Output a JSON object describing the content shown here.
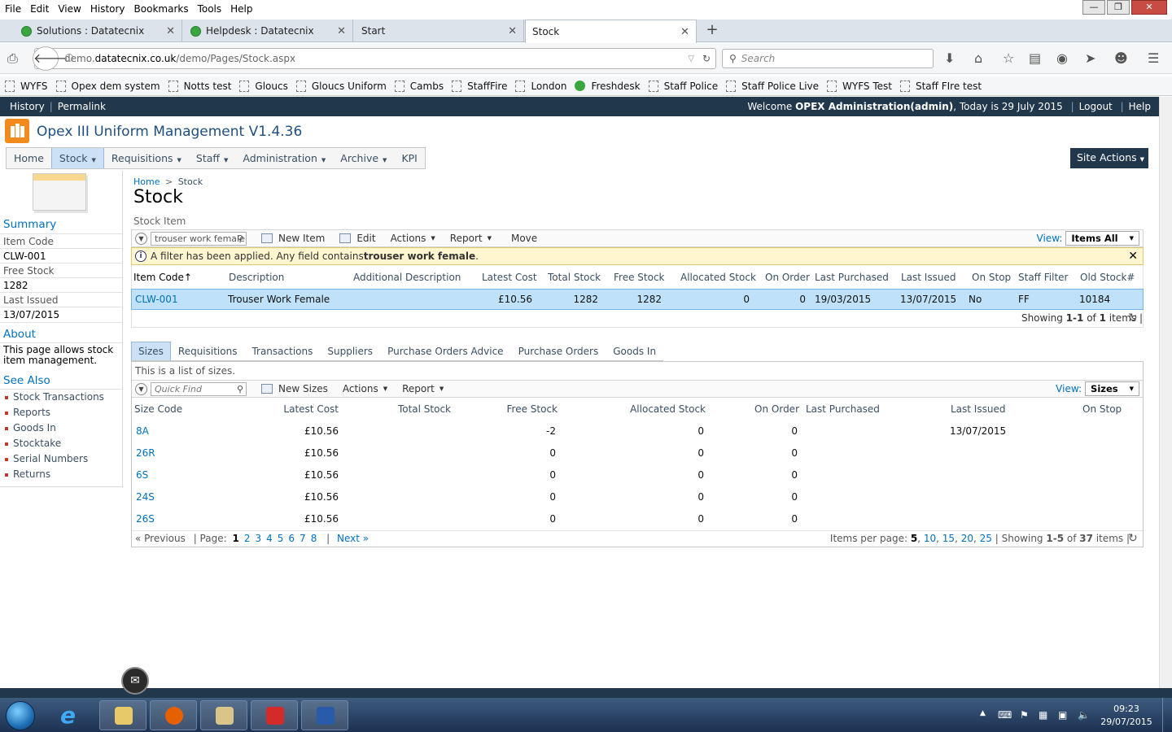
{
  "browser": {
    "menu": [
      "File",
      "Edit",
      "View",
      "History",
      "Bookmarks",
      "Tools",
      "Help"
    ],
    "tabs": [
      {
        "label": "Solutions : Datatecnix"
      },
      {
        "label": "Helpdesk : Datatecnix"
      },
      {
        "label": "Start"
      },
      {
        "label": "Stock"
      }
    ],
    "url_prefix": "demo.",
    "url_host": "datatecnix.co.uk",
    "url_path": "/demo/Pages/Stock.aspx",
    "search_placeholder": "Search",
    "bookmarks": [
      "WYFS",
      "Opex dem system",
      "Notts test",
      "Gloucs",
      "Gloucs Uniform",
      "Cambs",
      "StaffFire",
      "London",
      "Freshdesk",
      "Staff Police",
      "Staff Police Live",
      "WYFS Test",
      "Staff FIre test"
    ]
  },
  "sp": {
    "history": "History",
    "permalink": "Permalink",
    "welcome_prefix": "Welcome ",
    "welcome_user": "OPEX Administration(admin)",
    "welcome_date": ", Today is 29 July 2015",
    "logout": "Logout",
    "help": "Help",
    "app_title": "Opex III Uniform Management V1.4.36",
    "site_actions": "Site Actions",
    "topnav": [
      {
        "label": "Home",
        "dropdown": false
      },
      {
        "label": "Stock",
        "dropdown": true
      },
      {
        "label": "Requisitions",
        "dropdown": true
      },
      {
        "label": "Staff",
        "dropdown": true
      },
      {
        "label": "Administration",
        "dropdown": true
      },
      {
        "label": "Archive",
        "dropdown": true
      },
      {
        "label": "KPI",
        "dropdown": false
      }
    ]
  },
  "leftnav": {
    "summary_heading": "Summary",
    "item_code_label": "Item Code",
    "item_code_value": "CLW-001",
    "free_stock_label": "Free Stock",
    "free_stock_value": "1282",
    "last_issued_label": "Last Issued",
    "last_issued_value": "13/07/2015",
    "about_heading": "About",
    "about_text": "This page allows stock item management.",
    "see_also_heading": "See Also",
    "links": [
      "Stock Transactions",
      "Reports",
      "Goods In",
      "Stocktake",
      "Serial Numbers",
      "Returns"
    ]
  },
  "main": {
    "breadcrumb_home": "Home",
    "breadcrumb_sep": ">",
    "breadcrumb_current": "Stock",
    "title": "Stock",
    "section_label": "Stock Item",
    "toolbar": {
      "search_value": "trouser work female",
      "new_item": "New Item",
      "edit": "Edit",
      "actions": "Actions",
      "report": "Report",
      "move": "Move",
      "view_label": "View:",
      "view_value": "Items All"
    },
    "filter_prefix": "A filter has been applied. Any field contains ",
    "filter_term": "trouser work female",
    "filter_suffix": ".",
    "columns": [
      "Item Code",
      "Description",
      "Additional Description",
      "Latest Cost",
      "Total Stock",
      "Free Stock",
      "Allocated Stock",
      "On Order",
      "Last Purchased",
      "Last Issued",
      "On Stop",
      "Staff Filter",
      "Old Stock#"
    ],
    "sort_arrow": "↑",
    "row": {
      "item_code": "CLW-001",
      "description": "Trouser Work Female",
      "additional": "",
      "latest_cost": "£10.56",
      "total_stock": "1282",
      "free_stock": "1282",
      "allocated": "0",
      "on_order": "0",
      "last_purchased": "19/03/2015",
      "last_issued": "13/07/2015",
      "on_stop": "No",
      "staff_filter": "FF",
      "old_stock": "10184"
    },
    "showing_prefix": "Showing ",
    "showing_range": "1-1",
    "showing_of": " of ",
    "showing_total": "1",
    "showing_suffix": " items"
  },
  "sizes": {
    "tabs": [
      "Sizes",
      "Requisitions",
      "Transactions",
      "Suppliers",
      "Purchase Orders Advice",
      "Purchase Orders",
      "Goods In"
    ],
    "description": "This is a list of sizes.",
    "toolbar": {
      "quick_find": "Quick Find",
      "new_sizes": "New Sizes",
      "actions": "Actions",
      "report": "Report",
      "view_label": "View:",
      "view_value": "Sizes"
    },
    "columns": [
      "Size Code",
      "Latest Cost",
      "Total Stock",
      "Free Stock",
      "Allocated Stock",
      "On Order",
      "Last Purchased",
      "Last Issued",
      "On Stop"
    ],
    "rows": [
      {
        "code": "8A",
        "cost": "£10.56",
        "total": "",
        "free": "-2",
        "allocated": "0",
        "on_order": "0",
        "last_purchased": "",
        "last_issued": "13/07/2015",
        "on_stop": ""
      },
      {
        "code": "26R",
        "cost": "£10.56",
        "total": "",
        "free": "0",
        "allocated": "0",
        "on_order": "0",
        "last_purchased": "",
        "last_issued": "",
        "on_stop": ""
      },
      {
        "code": "6S",
        "cost": "£10.56",
        "total": "",
        "free": "0",
        "allocated": "0",
        "on_order": "0",
        "last_purchased": "",
        "last_issued": "",
        "on_stop": ""
      },
      {
        "code": "24S",
        "cost": "£10.56",
        "total": "",
        "free": "0",
        "allocated": "0",
        "on_order": "0",
        "last_purchased": "",
        "last_issued": "",
        "on_stop": ""
      },
      {
        "code": "26S",
        "cost": "£10.56",
        "total": "",
        "free": "0",
        "allocated": "0",
        "on_order": "0",
        "last_purchased": "",
        "last_issued": "",
        "on_stop": ""
      }
    ],
    "pager": {
      "previous": "« Previous",
      "page_label": "| Page:",
      "pages": [
        "1",
        "2",
        "3",
        "4",
        "5",
        "6",
        "7",
        "8"
      ],
      "current_page": "1",
      "next": "Next »",
      "ipp_label": "Items per page: ",
      "ipp": [
        "5",
        "10",
        "15",
        "20",
        "25"
      ],
      "showing_prefix": "| Showing ",
      "showing_range": "1-5",
      "showing_of": " of ",
      "showing_total": "37",
      "showing_suffix": " items"
    }
  },
  "taskbar": {
    "time": "09:23",
    "date": "29/07/2015"
  },
  "colors": {
    "ribbon": "#21374c",
    "link": "#0072bc",
    "selected_row": "#bfe1f9",
    "filter_bg": "#fff5cf"
  }
}
